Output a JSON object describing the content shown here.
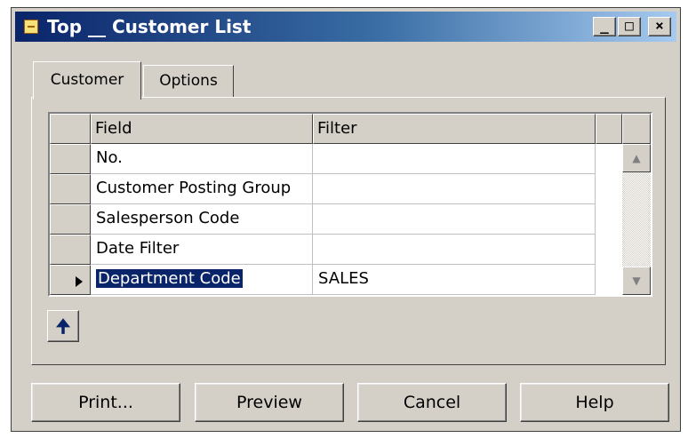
{
  "window": {
    "title": "Top __ Customer List",
    "controls": {
      "minimize": "_",
      "maximize": "□",
      "close": "×"
    }
  },
  "tabs": [
    {
      "label": "Customer",
      "active": true
    },
    {
      "label": "Options",
      "active": false
    }
  ],
  "grid": {
    "columns": [
      "Field",
      "Filter"
    ],
    "rows": [
      {
        "field": "No.",
        "filter": ""
      },
      {
        "field": "Customer Posting Group",
        "filter": ""
      },
      {
        "field": "Salesperson Code",
        "filter": ""
      },
      {
        "field": "Date Filter",
        "filter": ""
      },
      {
        "field": "Department Code",
        "filter": "SALES",
        "current": true
      }
    ]
  },
  "icons": {
    "app": "app-icon",
    "lookup": "arrow-up-icon",
    "scroll_up": "scroll-up-icon",
    "scroll_down": "scroll-down-icon",
    "row_indicator": "row-pointer-icon",
    "move_up": "arrow-up-icon"
  },
  "buttons": {
    "print": "Print...",
    "preview": "Preview",
    "cancel": "Cancel",
    "help": "Help"
  },
  "colors": {
    "selection": "#0a246a",
    "title_gradient_start": "#0a246a",
    "title_gradient_end": "#a6caf0"
  }
}
